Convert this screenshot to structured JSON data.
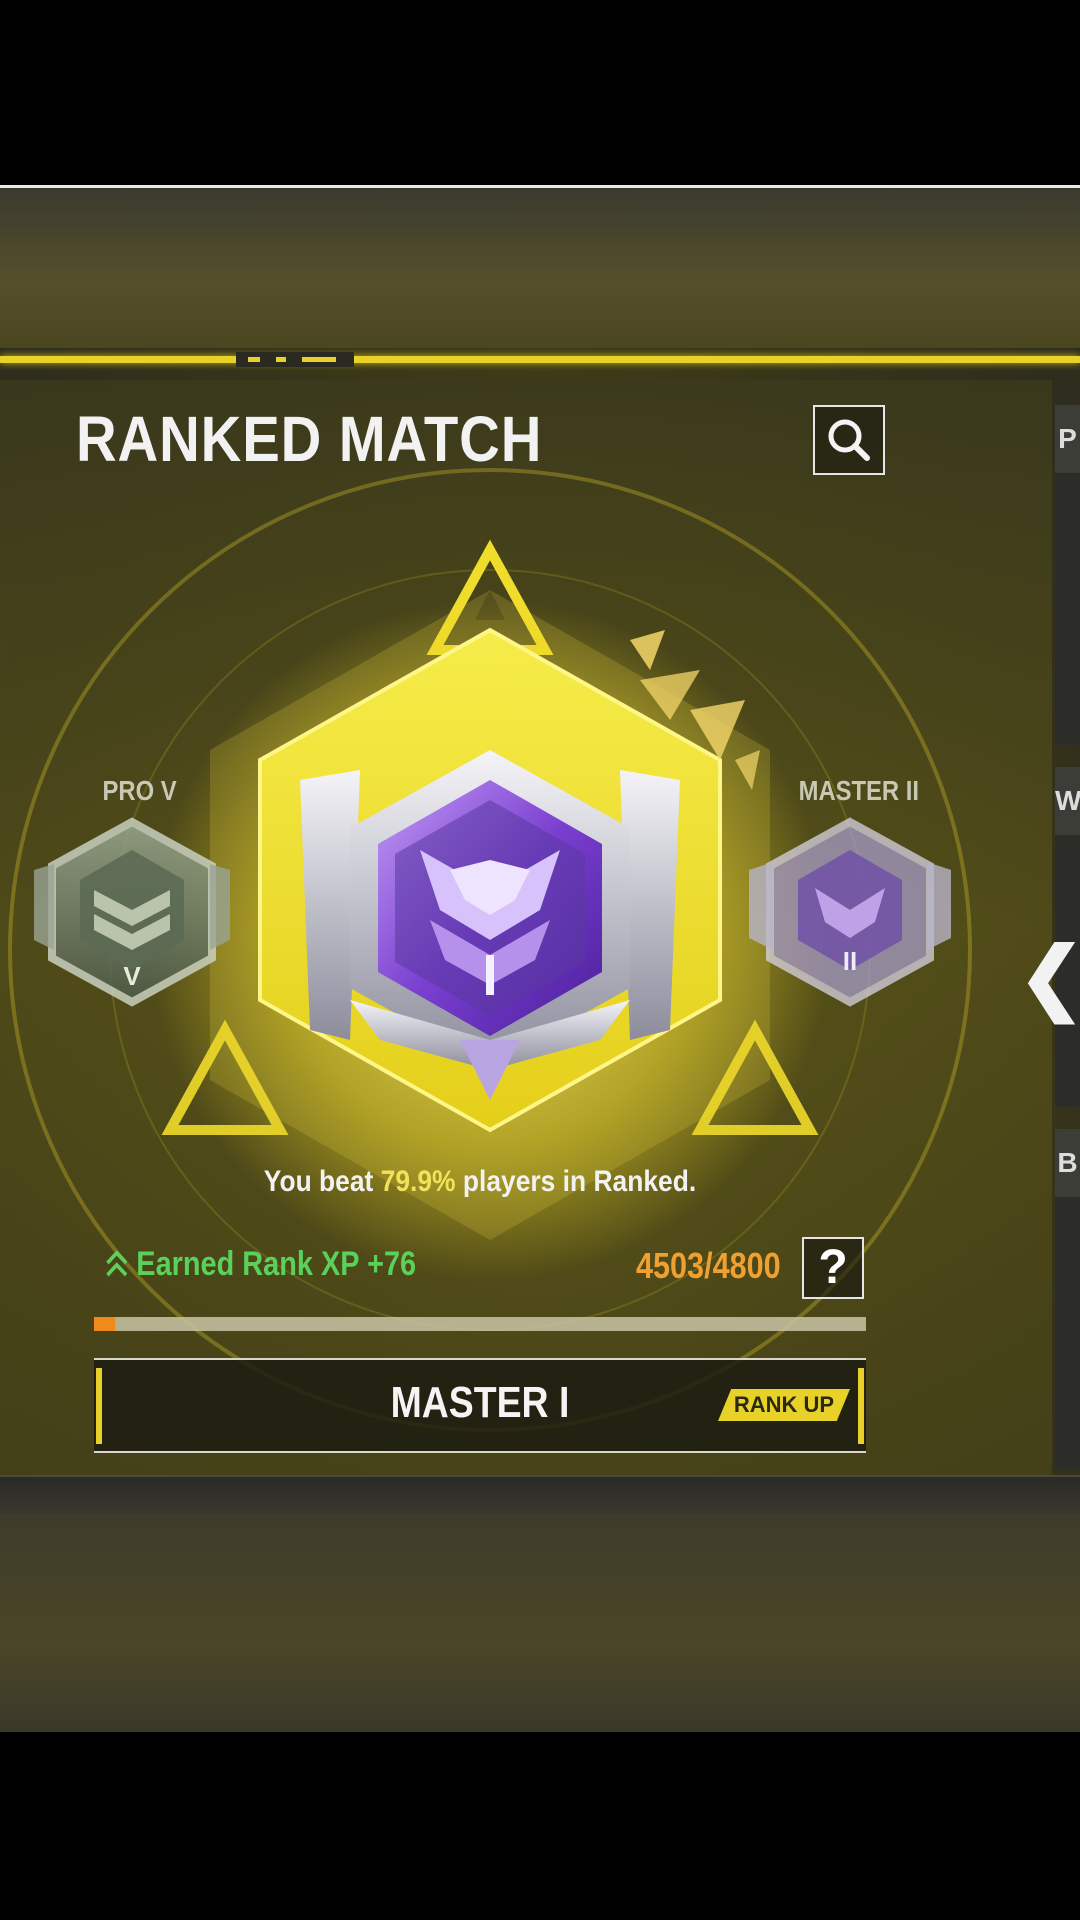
{
  "title": "RANKED MATCH",
  "ranks": {
    "previous": "PRO V",
    "current": "MASTER I",
    "next": "MASTER II"
  },
  "beat": {
    "prefix": "You beat ",
    "percent": "79.9%",
    "suffix": " players in Ranked."
  },
  "xp": {
    "earned_label": "Earned Rank XP +76",
    "progress_text": "4503/4800",
    "current": 4503,
    "max": 4800,
    "help_label": "?"
  },
  "rank_bar": {
    "name": "MASTER I",
    "badge": "RANK UP"
  },
  "side_panel": {
    "tabs": [
      "P",
      "W",
      "B"
    ],
    "arrow": "❮"
  },
  "icons": {
    "search": "search-icon",
    "chevrons": "double-chevron-up-icon"
  },
  "colors": {
    "accent_yellow": "#e8d22a",
    "xp_green": "#5ad15a",
    "xp_orange": "#f0a030",
    "percent_yellow": "#f1e25a",
    "badge_purple": "#8a4fd6"
  }
}
